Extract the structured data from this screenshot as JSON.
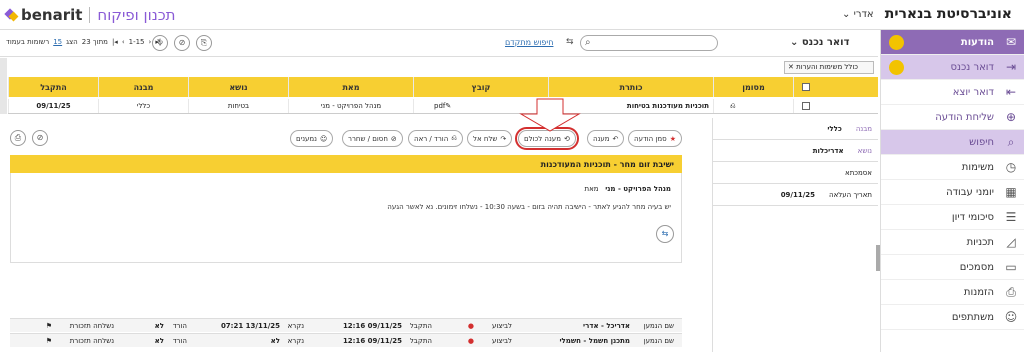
{
  "header": {
    "brand": "benarit",
    "system": "תכנון ופיקוח",
    "user": "אדרי",
    "university": "אוניברסיטת בנארית"
  },
  "sidebar": {
    "items": [
      {
        "label": "הודעות",
        "icon": "envelope-icon",
        "state": "active"
      },
      {
        "label": "דואר נכנס",
        "icon": "inbox-in-icon",
        "state": "selected"
      },
      {
        "label": "דואר יוצא",
        "icon": "outbox-icon",
        "state": ""
      },
      {
        "label": "שליחת הודעה",
        "icon": "plus-circle-icon",
        "state": ""
      },
      {
        "label": "חיפוש",
        "icon": "search-icon",
        "state": "lav"
      },
      {
        "label": "משימות",
        "icon": "clock-icon",
        "state": ""
      },
      {
        "label": "יומני עבודה",
        "icon": "calendar-icon",
        "state": ""
      },
      {
        "label": "סיכומי דיון",
        "icon": "notes-icon",
        "state": ""
      },
      {
        "label": "תכניות",
        "icon": "triangle-ruler-icon",
        "state": ""
      },
      {
        "label": "מסמכים",
        "icon": "folder-icon",
        "state": ""
      },
      {
        "label": "הזמנות",
        "icon": "printer-icon",
        "state": ""
      },
      {
        "label": "משתתפים",
        "icon": "person-icon",
        "state": ""
      }
    ]
  },
  "toolbar": {
    "inbox_title": "דואר נכנס",
    "advanced_search": "חיפוש מתקדם",
    "search_placeholder": "",
    "paging": {
      "range": "1-15",
      "of": "מתוך 23",
      "show": "הצג",
      "per_page": "15",
      "suffix": "רשומות בעמוד"
    }
  },
  "filter": {
    "label": "כולל משימות והערות"
  },
  "table": {
    "headers": [
      "",
      "מסומן",
      "כותרת",
      "קובץ",
      "מאת",
      "נושא",
      "מבנה",
      "התקבל"
    ],
    "rows": [
      {
        "title": "תוכניות מעודכנות בטיחות",
        "file": "pdf",
        "from": "מנהל הפרויקט - מני",
        "subject": "בטיחות",
        "building": "כללי",
        "received": "09/11/25"
      }
    ]
  },
  "details": {
    "rows": [
      {
        "label": "מבנה",
        "value": "כללי"
      },
      {
        "label": "נושא",
        "value": "אדריכלות"
      },
      {
        "label": "",
        "value": "אסמכתא"
      },
      {
        "label": "תאריך העלאה",
        "value": "09/11/25"
      }
    ]
  },
  "actions": {
    "mark": "סמן הודעה",
    "reply": "מענה",
    "reply_all": "מענה לכולם",
    "forward": "שלח אל",
    "download": "הורד / ראה",
    "archive": "חסום / שחרר",
    "recipients": "נמענים"
  },
  "message": {
    "title": "ישיבת זום מחר - תוכניות המעודכנות",
    "from_label": "מאת",
    "from": "מנהל הפרויקט - מני",
    "body": "יש בעיה מחר להגיע לאתר - הישיבה תהיה בזום - בשעה 10:30 - נשלחו זימונים. נא לאשר הגעה"
  },
  "footer": [
    {
      "name_label": "שם הנמען",
      "name": "אדריכל - אדרי",
      "status": "לביצוע",
      "received_label": "התקבל",
      "received": "12:16 09/11/25",
      "read_label": "נקרא",
      "read": "07:21 13/11/25",
      "dl_label": "הורד",
      "dl": "לא",
      "reminder": "נשלחה תזכורת"
    },
    {
      "name_label": "שם הנמען",
      "name": "מתכנן חשמל - חשמלי",
      "status": "לביצוע",
      "received_label": "התקבל",
      "received": "12:16 09/11/25",
      "read_label": "נקרא",
      "read": "לא",
      "dl_label": "הורד",
      "dl": "לא",
      "reminder": "נשלחה תזכורת"
    }
  ],
  "colors": {
    "accent": "#8e6bb5",
    "yellow": "#f7cf32",
    "highlight": "#d32f2f"
  }
}
